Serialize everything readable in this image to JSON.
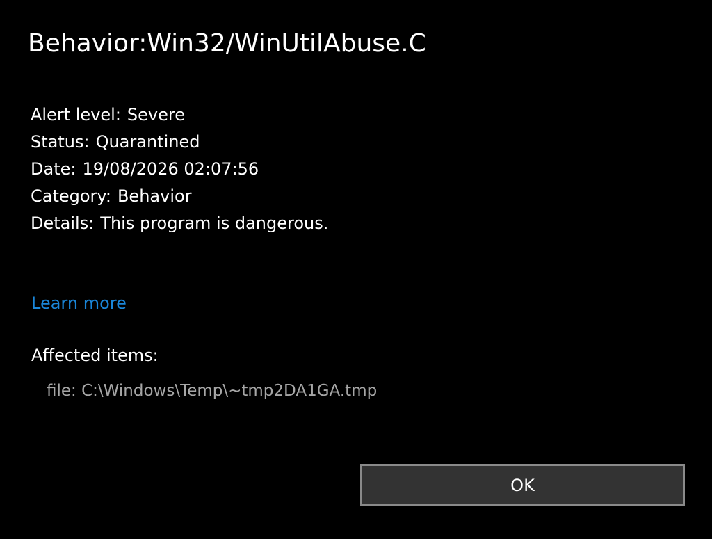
{
  "title": "Behavior:Win32/WinUtilAbuse.C",
  "details": [
    {
      "label": "Alert level:",
      "value": "Severe"
    },
    {
      "label": "Status:",
      "value": "Quarantined"
    },
    {
      "label": "Date:",
      "value": "19/08/2026 02:07:56"
    },
    {
      "label": "Category:",
      "value": "Behavior"
    },
    {
      "label": "Details:",
      "value": "This program is dangerous."
    }
  ],
  "learn_more": "Learn more",
  "affected": {
    "heading": "Affected items:",
    "items": [
      "file: C:\\Windows\\Temp\\~tmp2DA1GA.tmp"
    ]
  },
  "ok_label": "OK",
  "colors": {
    "background": "#000000",
    "link": "#1a86d9",
    "button_bg": "#333333",
    "button_border": "#8a8a8a",
    "muted_text": "#a6a6a6"
  }
}
